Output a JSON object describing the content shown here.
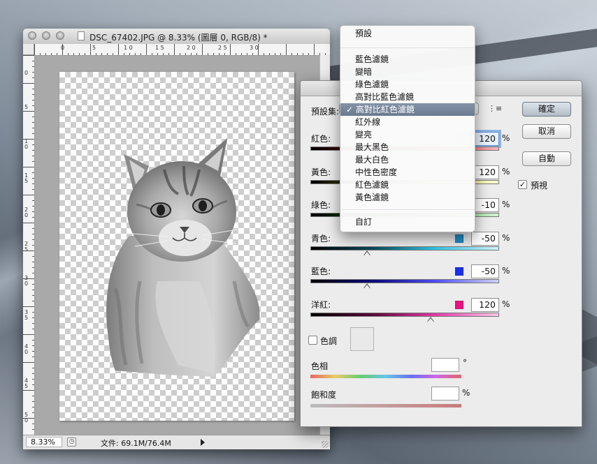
{
  "document": {
    "title": "DSC_67402.JPG @ 8.33% (圖層 0, RGB/8) *",
    "zoom": "8.33%",
    "file_info": "文件: 69.1M/76.4M",
    "ruler_h": [
      "0",
      "5",
      "1 0",
      "1 5",
      "2 0",
      "2 5",
      "3 0"
    ],
    "ruler_v": [
      "0",
      "5",
      "1 0",
      "1 5",
      "2 0",
      "2 5",
      "3 0",
      "3 5",
      "4 0",
      "4 5",
      "5 0"
    ]
  },
  "dialog": {
    "preset_label": "預設集:",
    "channels": [
      {
        "label": "紅色:",
        "value": "120",
        "color": "#f2d7dc"
      },
      {
        "label": "黃色:",
        "value": "120",
        "color": "#f6f6e4"
      },
      {
        "label": "綠色:",
        "value": "-10",
        "color": "#e7f4e7"
      },
      {
        "label": "青色:",
        "value": "-50",
        "color": "#1e90cc"
      },
      {
        "label": "藍色:",
        "value": "-50",
        "color": "#1a2fe8"
      },
      {
        "label": "洋紅:",
        "value": "120",
        "color": "#e8127f"
      }
    ],
    "percent": "%",
    "buttons": {
      "ok": "確定",
      "cancel": "取消",
      "auto": "自動"
    },
    "preview": "預視",
    "tint": "色調",
    "hue": "色相",
    "hue_unit": "°",
    "saturation": "飽和度",
    "saturation_unit": "%"
  },
  "preset_menu": {
    "top": "預設",
    "items": [
      "藍色濾鏡",
      "變暗",
      "綠色濾鏡",
      "高對比藍色濾鏡",
      "高對比紅色濾鏡",
      "紅外線",
      "變亮",
      "最大黑色",
      "最大白色",
      "中性色密度",
      "紅色濾鏡",
      "黃色濾鏡"
    ],
    "selected_index": 4,
    "checkmark": "✓",
    "custom": "自訂"
  }
}
